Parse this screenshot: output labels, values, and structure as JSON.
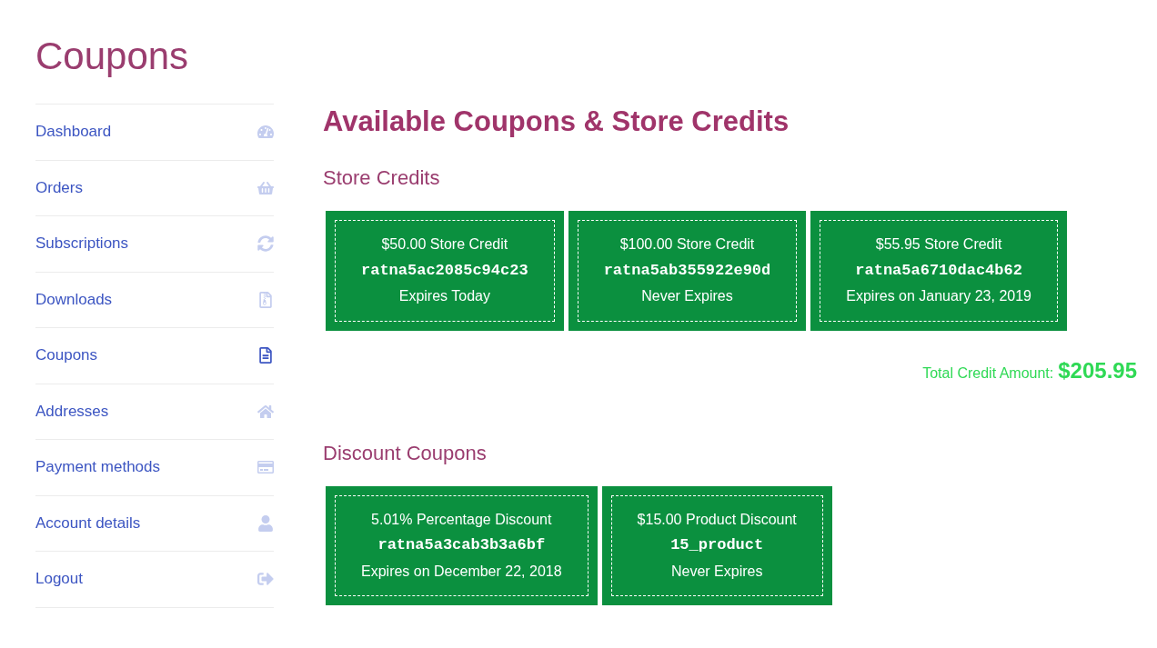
{
  "page_title": "Coupons",
  "nav": {
    "items": [
      {
        "label": "Dashboard",
        "selected": false
      },
      {
        "label": "Orders",
        "selected": false
      },
      {
        "label": "Subscriptions",
        "selected": false
      },
      {
        "label": "Downloads",
        "selected": false
      },
      {
        "label": "Coupons",
        "selected": true
      },
      {
        "label": "Addresses",
        "selected": false
      },
      {
        "label": "Payment methods",
        "selected": false
      },
      {
        "label": "Account details",
        "selected": false
      },
      {
        "label": "Logout",
        "selected": false
      }
    ]
  },
  "main": {
    "heading": "Available Coupons & Store Credits",
    "store_credits": {
      "title": "Store Credits",
      "cards": [
        {
          "title": "$50.00 Store Credit",
          "code": "ratna5ac2085c94c23",
          "expiry": "Expires Today"
        },
        {
          "title": "$100.00 Store Credit",
          "code": "ratna5ab355922e90d",
          "expiry": "Never Expires"
        },
        {
          "title": "$55.95 Store Credit",
          "code": "ratna5a6710dac4b62",
          "expiry": "Expires on January 23, 2019"
        }
      ],
      "total": {
        "label": "Total Credit Amount:",
        "amount": "$205.95"
      }
    },
    "discount_coupons": {
      "title": "Discount Coupons",
      "cards": [
        {
          "title": "5.01% Percentage Discount",
          "code": "ratna5a3cab3b3a6bf",
          "expiry": "Expires on December 22, 2018"
        },
        {
          "title": "$15.00 Product Discount",
          "code": "15_product",
          "expiry": "Never Expires"
        }
      ]
    }
  }
}
